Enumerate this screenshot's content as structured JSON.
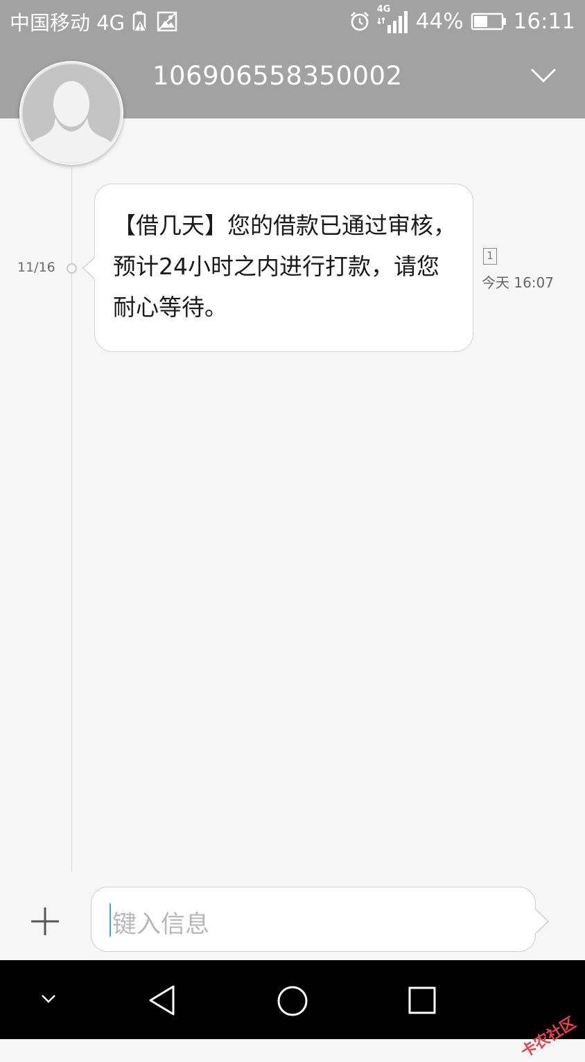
{
  "status_bar": {
    "carrier": "中国移动 4G",
    "network_badge": "4G",
    "battery": "44%",
    "time": "16:11",
    "icons": [
      "battery-warning-icon",
      "image-notification-icon",
      "alarm-icon",
      "signal-icon",
      "battery-icon"
    ]
  },
  "header": {
    "title": "106906558350002",
    "menu_icon": "chevron-down-icon",
    "avatar_icon": "person-silhouette-icon"
  },
  "conversation": {
    "messages": [
      {
        "date": "11/16",
        "text": "【借几天】您的借款已通过审核，预计24小时之内进行打款，请您耐心等待。",
        "sim_slot": "1",
        "time": "今天 16:07"
      }
    ]
  },
  "compose": {
    "placeholder": "键入信息",
    "add_icon": "plus-icon"
  },
  "nav_bar": {
    "icons": [
      "chevron-down-icon",
      "back-triangle-icon",
      "home-circle-icon",
      "recents-square-icon"
    ]
  },
  "watermark": {
    "text": "卡农社区"
  },
  "colors": {
    "header_bg": "#a2a2a2",
    "page_bg": "#f6f6f7",
    "bubble_bg": "#ffffff",
    "caret": "#3fa7b6",
    "nav_bg": "#000000",
    "watermark": "#e8434a"
  }
}
